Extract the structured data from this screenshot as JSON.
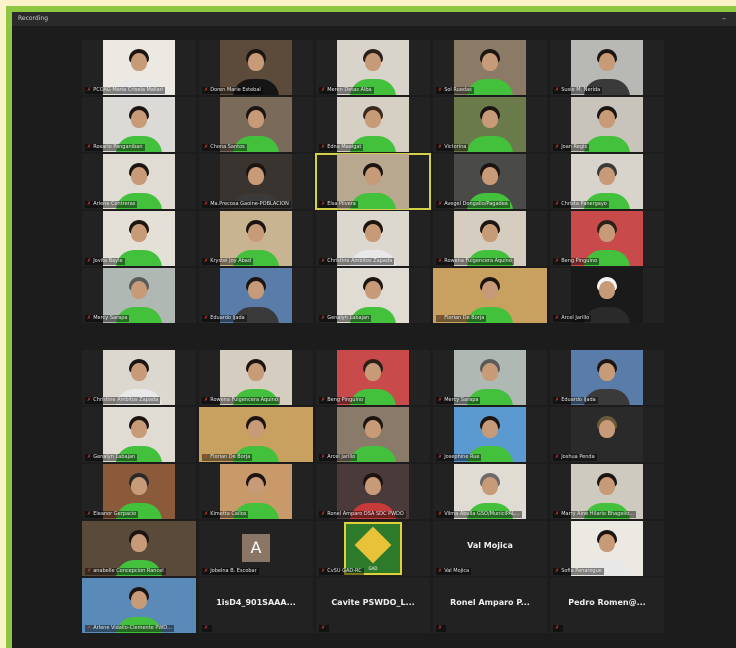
{
  "window": {
    "title": "Recording"
  },
  "tiles": [
    {
      "name": "PCOAG Maria Crisela Mallari",
      "bg": "#ece8e2",
      "hair": "#1b1410",
      "shirt": "#e8e8e8",
      "kind": "photo"
    },
    {
      "name": "Doren Marie Estebal",
      "bg": "#5c4a3a",
      "hair": "#1b1410",
      "shirt": "#151515",
      "kind": "photo"
    },
    {
      "name": "Meren Detas Alba",
      "bg": "#d8d4cc",
      "hair": "#2a2018",
      "shirt": "#43c03c",
      "kind": "photo"
    },
    {
      "name": "Sol Ruedas",
      "bg": "#8b7a66",
      "hair": "#1b1410",
      "shirt": "#43c03c",
      "kind": "photo"
    },
    {
      "name": "Susie M. Nerida",
      "bg": "#b8b8b4",
      "hair": "#1b1410",
      "shirt": "#3a3a3a",
      "kind": "photo"
    },
    {
      "name": "Rosario Panganiban",
      "bg": "#dcdad6",
      "hair": "#1b1410",
      "shirt": "#43c03c",
      "kind": "photo"
    },
    {
      "name": "Chona Santos",
      "bg": "#7a6a5a",
      "hair": "#1b1410",
      "shirt": "#43c03c",
      "kind": "photo"
    },
    {
      "name": "Edna Maaigat",
      "bg": "#d6d0c4",
      "hair": "#3a2a1a",
      "shirt": "#43c03c",
      "kind": "photo"
    },
    {
      "name": "Victorina",
      "bg": "#6a7a4a",
      "hair": "#1b1410",
      "shirt": "#43c03c",
      "kind": "photo"
    },
    {
      "name": "Joan Regis",
      "bg": "#c8c4bc",
      "hair": "#1b1410",
      "shirt": "#43c03c",
      "kind": "photo"
    },
    {
      "name": "Arlene Contreras",
      "bg": "#e0dcd4",
      "hair": "#1b1410",
      "shirt": "#43c03c",
      "kind": "photo"
    },
    {
      "name": "Ma.Precosa Gaoine-POBLACION",
      "bg": "#3a3430",
      "hair": "#1b1410",
      "shirt": "#3a3a3a",
      "kind": "photo"
    },
    {
      "name": "Elsa Pilvera",
      "bg": "#b8a890",
      "hair": "#1b1410",
      "shirt": "#43c03c",
      "kind": "photo",
      "active": true
    },
    {
      "name": "Avegel Dongallo/Pagadea",
      "bg": "#4a4a48",
      "hair": "#1b1410",
      "shirt": "#43c03c",
      "kind": "photo"
    },
    {
      "name": "Christa Panergayo",
      "bg": "#d8d4cc",
      "hair": "#3a3a3a",
      "shirt": "#43c03c",
      "kind": "photo"
    },
    {
      "name": "Jovita Bayle",
      "bg": "#e4e0d8",
      "hair": "#1b1410",
      "shirt": "#43c03c",
      "kind": "photo"
    },
    {
      "name": "Krystel Joy Abad",
      "bg": "#c8b490",
      "hair": "#1b1410",
      "shirt": "#43c03c",
      "kind": "photo"
    },
    {
      "name": "Christine Ambitos Zapada",
      "bg": "#dcd8d0",
      "hair": "#1b1410",
      "shirt": "#e8e8e8",
      "kind": "photo"
    },
    {
      "name": "Rowena Fulgencera Aquino",
      "bg": "#d4cdc0",
      "hair": "#1b1410",
      "shirt": "#43c03c",
      "kind": "photo"
    },
    {
      "name": "Beng Pinguino",
      "bg": "#c84a4a",
      "hair": "#2a2018",
      "shirt": "#43c03c",
      "kind": "photo"
    },
    {
      "name": "Mercy Sarapa",
      "bg": "#b0b8b4",
      "hair": "#5a5a5a",
      "shirt": "#43c03c",
      "kind": "photo"
    },
    {
      "name": "Eduardo Ijada",
      "bg": "#5a7ca8",
      "hair": "#1b1410",
      "shirt": "#3a3a3a",
      "kind": "photo"
    },
    {
      "name": "Genalyn Labajan",
      "bg": "#e0dcd4",
      "hair": "#1b1410",
      "shirt": "#43c03c",
      "kind": "photo"
    },
    {
      "name": "Florian De Borja",
      "bg": "#c8a060",
      "hair": "#1b1410",
      "shirt": "#43c03c",
      "kind": "wide"
    },
    {
      "name": "Arcel Jarillo",
      "bg": "#1a1a1a",
      "hair": "#f4f4f4",
      "shirt": "#2a2a2a",
      "kind": "photo"
    },
    {
      "name": "Christine Ambitos Zapada",
      "bg": "#dcd8d0",
      "hair": "#1b1410",
      "shirt": "#e8e8e8",
      "kind": "photo"
    },
    {
      "name": "Rowena Fulgencera Aquino",
      "bg": "#d4cdc0",
      "hair": "#1b1410",
      "shirt": "#43c03c",
      "kind": "photo"
    },
    {
      "name": "Beng Pinguino",
      "bg": "#c84a4a",
      "hair": "#2a2018",
      "shirt": "#43c03c",
      "kind": "photo"
    },
    {
      "name": "Mercy Sarapa",
      "bg": "#b0b8b4",
      "hair": "#5a5a5a",
      "shirt": "#43c03c",
      "kind": "photo"
    },
    {
      "name": "Eduardo Ijada",
      "bg": "#5a7ca8",
      "hair": "#1b1410",
      "shirt": "#3a3a3a",
      "kind": "photo"
    },
    {
      "name": "Genalyn Labajan",
      "bg": "#e0dcd4",
      "hair": "#1b1410",
      "shirt": "#43c03c",
      "kind": "photo"
    },
    {
      "name": "Florian De Borja",
      "bg": "#c8a060",
      "hair": "#1b1410",
      "shirt": "#43c03c",
      "kind": "wide"
    },
    {
      "name": "Arcel Jarillo",
      "bg": "#8a7a6a",
      "hair": "#1b1410",
      "shirt": "#43c03c",
      "kind": "photo"
    },
    {
      "name": "Josephine Rue",
      "bg": "#5a9ad0",
      "hair": "#1b1410",
      "shirt": "#43c03c",
      "kind": "photo"
    },
    {
      "name": "Joshua Penda",
      "bg": "#2a2a2a",
      "hair": "#6a5a3a",
      "shirt": "#2a2a2a",
      "kind": "photo"
    },
    {
      "name": "Eleanor Gerpacio",
      "bg": "#8a5a3a",
      "hair": "#2a2a2a",
      "shirt": "#43c03c",
      "kind": "photo"
    },
    {
      "name": "Kimetta Callos",
      "bg": "#c89a6a",
      "hair": "#1b1410",
      "shirt": "#43c03c",
      "kind": "photo"
    },
    {
      "name": "Ronel Amparo DSA SDC PWDO",
      "bg": "#4a3a3a",
      "hair": "#1b1410",
      "shirt": "#c83a3a",
      "kind": "photo"
    },
    {
      "name": "Vilma Abulla GSO/MuniciPAL...",
      "bg": "#e0dcd4",
      "hair": "#6a6a6a",
      "shirt": "#43c03c",
      "kind": "photo"
    },
    {
      "name": "Marry Aine Hilario Bhageilo...",
      "bg": "#cfcac0",
      "hair": "#1b1410",
      "shirt": "#43c03c",
      "kind": "photo"
    },
    {
      "name": "anabelle Concepcion Rancel",
      "bg": "#5a4a3a",
      "hair": "#1b1410",
      "shirt": "#43c03c",
      "kind": "wide"
    },
    {
      "name": "Jobelna B. Escobar",
      "big": "A",
      "kind": "letter"
    },
    {
      "name": "CvSU GAD-RC",
      "kind": "logo",
      "logo_text": "GAD"
    },
    {
      "name": "Val Mojica",
      "big": "Val Mojica",
      "kind": "text"
    },
    {
      "name": "Sofia Penarogue",
      "bg": "#ece8e2",
      "hair": "#1b1410",
      "shirt": "#e8e8e8",
      "kind": "photo"
    },
    {
      "name": "Arlene Vidallo-Clemente PWD...",
      "bg": "#5a8ab8",
      "hair": "#1b1410",
      "shirt": "#43c03c",
      "kind": "wide"
    },
    {
      "name": "",
      "big": "1isD4_901SAAA...",
      "kind": "text"
    },
    {
      "name": "",
      "big": "Cavite PSWDO_L...",
      "kind": "text"
    },
    {
      "name": "",
      "big": "Ronel Amparo P...",
      "kind": "text"
    },
    {
      "name": "",
      "big": "Pedro Romen@...",
      "kind": "text"
    }
  ]
}
